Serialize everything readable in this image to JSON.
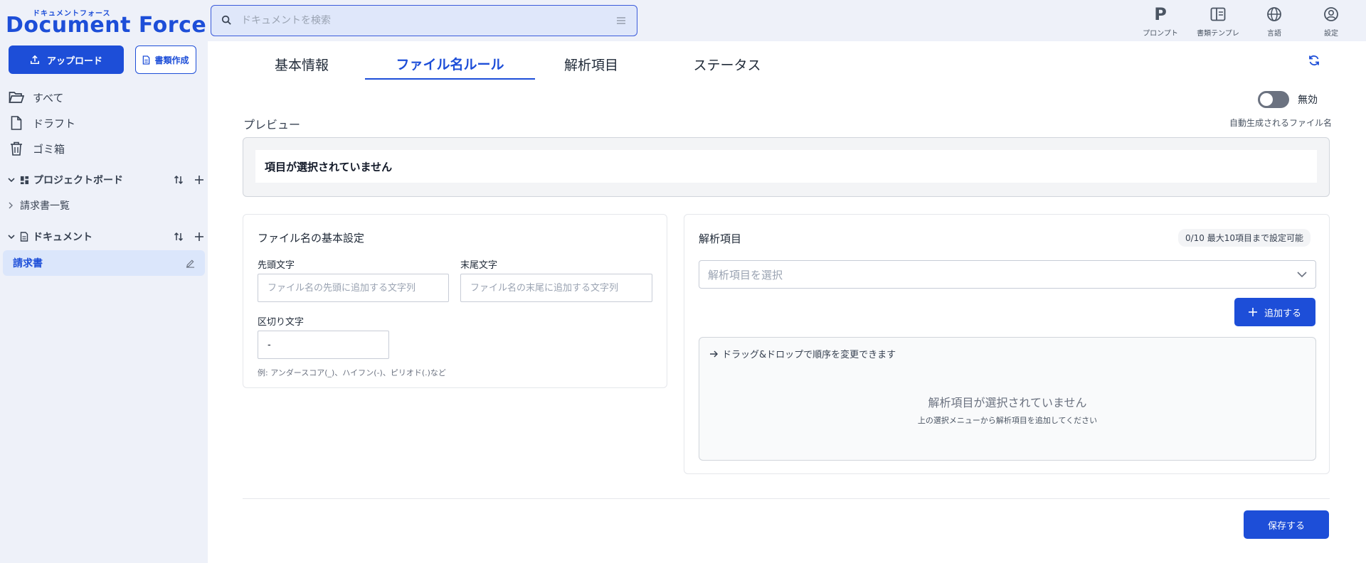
{
  "app": {
    "logo_kana": "ドキュメントフォース",
    "logo_text": "Document Force"
  },
  "search": {
    "placeholder": "ドキュメントを検索"
  },
  "header_tools": [
    {
      "label": "プロンプト",
      "icon": "prompt-icon"
    },
    {
      "label": "書類テンプレ",
      "icon": "template-icon"
    },
    {
      "label": "言語",
      "icon": "globe-icon"
    },
    {
      "label": "設定",
      "icon": "user-settings-icon"
    }
  ],
  "sidebar": {
    "upload_label": "アップロード",
    "create_label": "書類作成",
    "nav": [
      {
        "label": "すべて",
        "icon": "folder-open-icon"
      },
      {
        "label": "ドラフト",
        "icon": "file-icon"
      },
      {
        "label": "ゴミ箱",
        "icon": "trash-icon"
      }
    ],
    "project_board": {
      "title": "プロジェクトボード",
      "items": [
        "請求書一覧"
      ]
    },
    "documents": {
      "title": "ドキュメント",
      "items": [
        "請求書"
      ]
    }
  },
  "tabs": [
    {
      "label": "基本情報",
      "active": false
    },
    {
      "label": "ファイル名ルール",
      "active": true
    },
    {
      "label": "解析項目",
      "active": false
    },
    {
      "label": "ステータス",
      "active": false
    }
  ],
  "toggle": {
    "label": "無効",
    "enabled": false
  },
  "preview": {
    "title": "プレビュー",
    "hint": "自動生成されるファイル名",
    "value": "項目が選択されていません"
  },
  "basic_settings": {
    "title": "ファイル名の基本設定",
    "prefix_label": "先頭文字",
    "prefix_placeholder": "ファイル名の先頭に追加する文字列",
    "suffix_label": "末尾文字",
    "suffix_placeholder": "ファイル名の末尾に追加する文字列",
    "separator_label": "区切り文字",
    "separator_value": "-",
    "example": "例: アンダースコア(_)、ハイフン(-)、ピリオド(.)など"
  },
  "analysis_items": {
    "title": "解析項目",
    "count_badge": "0/10 最大10項目まで設定可能",
    "select_placeholder": "解析項目を選択",
    "add_label": "追加する",
    "drag_hint": "ドラッグ&ドロップで順序を変更できます",
    "empty_title": "解析項目が選択されていません",
    "empty_sub": "上の選択メニューから解析項目を追加してください"
  },
  "save_label": "保存する",
  "colors": {
    "accent": "#1d4ed8",
    "sidebar_bg": "#eef1f9",
    "active_item_bg": "#dbe6fb"
  }
}
